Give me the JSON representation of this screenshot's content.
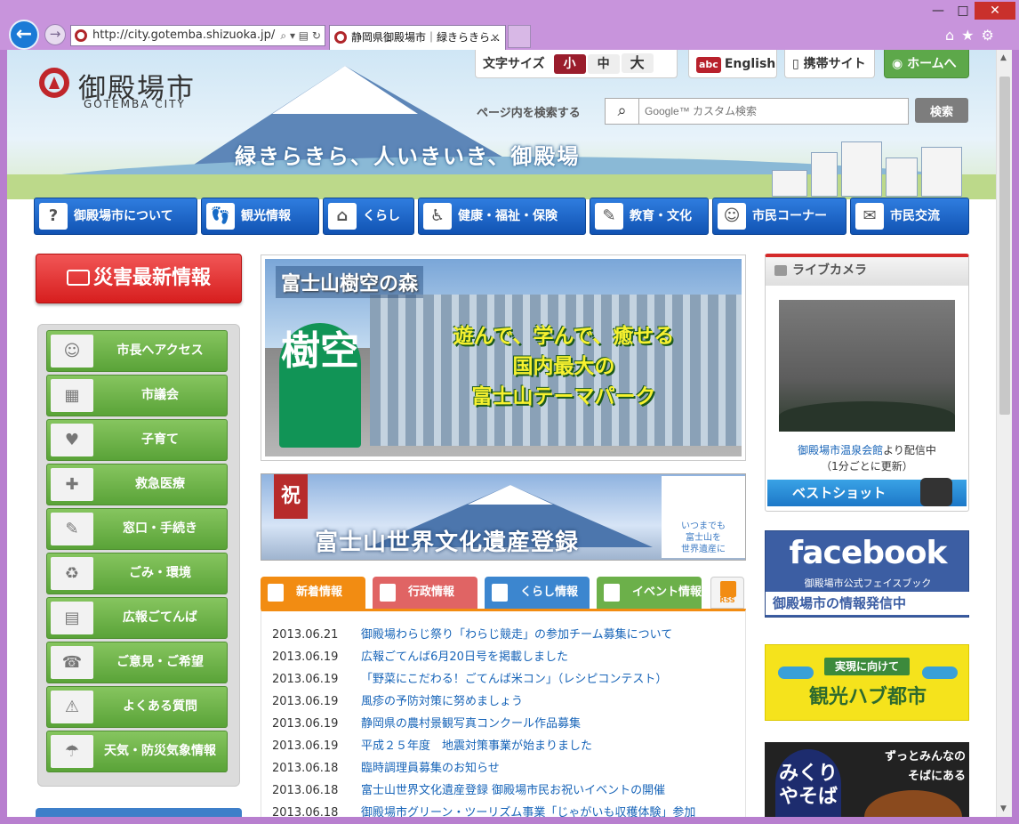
{
  "browser": {
    "url": "http://city.gotemba.shizuoka.jp/",
    "tab_title": "静岡県御殿場市｜緑きらきら...",
    "tab_close": "×",
    "window_min": "—",
    "window_max": "□",
    "window_close": "✕",
    "icons": [
      "back-icon",
      "forward-icon",
      "home-icon",
      "favorites-icon",
      "settings-icon"
    ]
  },
  "header": {
    "logo_text": "御殿場市",
    "logo_sub": "GOTEMBA CITY",
    "tagline": "緑きらきら、人いきいき、御殿場",
    "font_size_label": "文字サイズ",
    "font_small": "小",
    "font_mid": "中",
    "font_large": "大",
    "english_badge": "abc",
    "english_label": "English",
    "mobile_label": "携帯サイト",
    "home_label": "ホームへ",
    "search_label": "ページ内を検索する",
    "search_placeholder": "Google™ カスタム検索",
    "search_button": "検索"
  },
  "main_nav": [
    {
      "label": "御殿場市について",
      "icon": "?"
    },
    {
      "label": "観光情報",
      "icon": "👣"
    },
    {
      "label": "くらし",
      "icon": "⌂"
    },
    {
      "label": "健康・福祉・保険",
      "icon": "♿"
    },
    {
      "label": "教育・文化",
      "icon": "✎"
    },
    {
      "label": "市民コーナー",
      "icon": "☺"
    },
    {
      "label": "市民交流",
      "icon": "✉"
    }
  ],
  "sidebar": {
    "disaster_label": "災害最新情報",
    "items": [
      {
        "label": "市長へアクセス",
        "icon": "☺"
      },
      {
        "label": "市議会",
        "icon": "▦"
      },
      {
        "label": "子育て",
        "icon": "♥"
      },
      {
        "label": "救急医療",
        "icon": "✚"
      },
      {
        "label": "窓口・手続き",
        "icon": "✎"
      },
      {
        "label": "ごみ・環境",
        "icon": "♻"
      },
      {
        "label": "広報ごてんば",
        "icon": "▤"
      },
      {
        "label": "ご意見・ご希望",
        "icon": "☎"
      },
      {
        "label": "よくある質問",
        "icon": "⚠"
      },
      {
        "label": "天気・防災気象情報",
        "icon": "☂"
      }
    ]
  },
  "banners": {
    "forest_title": "富士山樹空の森",
    "forest_logo": "樹空",
    "forest_copy_1": "遊んで、学んで、癒せる",
    "forest_copy_2": "国内最大の",
    "forest_copy_3": "富士山テーマパーク",
    "heritage_badge": "祝",
    "heritage_title": "富士山世界文化遺産登録",
    "heritage_side_1": "いつまでも",
    "heritage_side_2": "富士山を",
    "heritage_side_3": "世界遺産に"
  },
  "news": {
    "tabs": [
      "新着情報",
      "行政情報",
      "くらし情報",
      "イベント情報"
    ],
    "rss_label": "RSS",
    "items": [
      {
        "date": "2013.06.21",
        "title": "御殿場わらじ祭り「わらじ競走」の参加チーム募集について"
      },
      {
        "date": "2013.06.19",
        "title": "広報ごてんば6月20日号を掲載しました"
      },
      {
        "date": "2013.06.19",
        "title": "「野菜にこだわる！ごてんば米コン」（レシピコンテスト）"
      },
      {
        "date": "2013.06.19",
        "title": "風疹の予防対策に努めましょう"
      },
      {
        "date": "2013.06.19",
        "title": "静岡県の農村景観写真コンクール作品募集"
      },
      {
        "date": "2013.06.19",
        "title": "平成２５年度　地震対策事業が始まりました"
      },
      {
        "date": "2013.06.18",
        "title": "臨時調理員募集のお知らせ"
      },
      {
        "date": "2013.06.18",
        "title": "富士山世界文化遺産登録 御殿場市民お祝いイベントの開催"
      },
      {
        "date": "2013.06.18",
        "title": "御殿場市グリーン・ツーリズム事業「じゃがいも収穫体験」参加"
      }
    ]
  },
  "right": {
    "livecam_title": "ライブカメラ",
    "livecam_source_link": "御殿場市温泉会館",
    "livecam_source_suffix": "より配信中",
    "livecam_note": "（1分ごとに更新）",
    "bestshot_label": "ベストショット",
    "facebook_logo": "facebook",
    "facebook_sub": "御殿場市公式フェイスブック",
    "facebook_band": "御殿場市の情報発信中",
    "hub_sub": "実現に向けて",
    "hub_title": "観光ハブ都市",
    "soba_label": "みくりやそば",
    "soba_copy_1": "ずっとみんなの",
    "soba_copy_2": "そばにある"
  }
}
